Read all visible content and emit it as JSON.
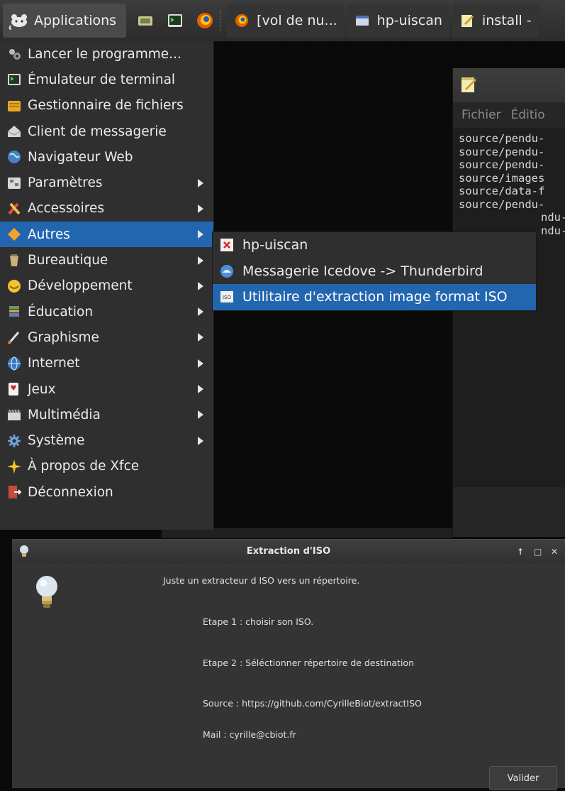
{
  "panel": {
    "applications_label": "Applications",
    "tasks": [
      {
        "label": "[vol de nu...",
        "icon": "firefox-icon"
      },
      {
        "label": "hp-uiscan",
        "icon": "window-icon"
      },
      {
        "label": "install -",
        "icon": "text-editor-icon"
      }
    ]
  },
  "menu": {
    "items": [
      {
        "label": "Lancer le programme...",
        "icon": "run-program-icon",
        "submenu": false
      },
      {
        "label": "Émulateur de terminal",
        "icon": "terminal-icon",
        "submenu": false
      },
      {
        "label": "Gestionnaire de fichiers",
        "icon": "file-manager-icon",
        "submenu": false
      },
      {
        "label": "Client de messagerie",
        "icon": "mail-client-icon",
        "submenu": false
      },
      {
        "label": "Navigateur Web",
        "icon": "web-browser-icon",
        "submenu": false
      },
      {
        "label": "Paramètres",
        "icon": "settings-icon",
        "submenu": true
      },
      {
        "label": "Accessoires",
        "icon": "accessories-icon",
        "submenu": true
      },
      {
        "label": "Autres",
        "icon": "others-icon",
        "submenu": true,
        "active": true
      },
      {
        "label": "Bureautique",
        "icon": "office-icon",
        "submenu": true
      },
      {
        "label": "Développement",
        "icon": "development-icon",
        "submenu": true
      },
      {
        "label": "Éducation",
        "icon": "education-icon",
        "submenu": true
      },
      {
        "label": "Graphisme",
        "icon": "graphics-icon",
        "submenu": true
      },
      {
        "label": "Internet",
        "icon": "internet-icon",
        "submenu": true
      },
      {
        "label": "Jeux",
        "icon": "games-icon",
        "submenu": true
      },
      {
        "label": "Multimédia",
        "icon": "multimedia-icon",
        "submenu": true
      },
      {
        "label": "Système",
        "icon": "system-icon",
        "submenu": true
      },
      {
        "label": "À propos de Xfce",
        "icon": "about-xfce-icon",
        "submenu": false
      },
      {
        "label": "Déconnexion",
        "icon": "logout-icon",
        "submenu": false
      }
    ]
  },
  "submenu": {
    "items": [
      {
        "label": "hp-uiscan",
        "icon": "hp-uiscan-icon"
      },
      {
        "label": "Messagerie Icedove -> Thunderbird",
        "icon": "thunderbird-icon"
      },
      {
        "label": "Utilitaire d'extraction image format ISO",
        "icon": "iso-icon",
        "active": true
      }
    ]
  },
  "editor": {
    "menu": [
      "Fichier",
      "Éditio"
    ],
    "lines": [
      "source/pendu-",
      "source/pendu-",
      "source/pendu-",
      "source/images",
      "source/data-f",
      "source/pendu-",
      "ndu-",
      "ndu-"
    ]
  },
  "dialog": {
    "title": "Extraction d'ISO",
    "intro": "Juste un extracteur d ISO vers un répertoire.",
    "step1": "Etape 1 : choisir son ISO.",
    "step2": "Etape 2 : Séléctionner répertoire de destination",
    "source": "Source : https://github.com/CyrilleBiot/extractISO",
    "mail": "Mail : cyrille@cbiot.fr",
    "validate_label": "Valider"
  },
  "colors": {
    "highlight": "#2266b0",
    "menu_bg": "#2f2f2f",
    "dialog_bg": "#343434"
  }
}
